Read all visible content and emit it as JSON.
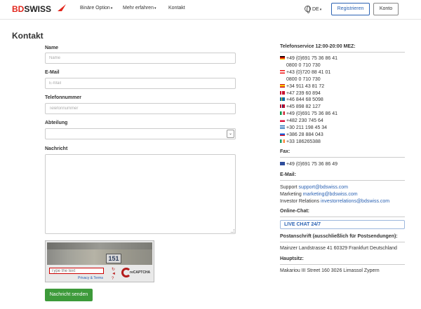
{
  "header": {
    "logo_red": "BD",
    "logo_dark": "SWISS",
    "nav": [
      {
        "label": "Binäre Option"
      },
      {
        "label": "Mehr erfahren"
      },
      {
        "label": "Kontakt"
      }
    ],
    "language": "DE",
    "register_label": "Registrieren",
    "account_label": "Konto"
  },
  "form": {
    "title": "Kontakt",
    "name_label": "Name",
    "name_placeholder": "Name",
    "email_label": "E-Mail",
    "email_placeholder": "E-Mail",
    "phone_label": "Telefonnummer",
    "phone_placeholder": "Telefonnummer",
    "department_label": "Abteilung",
    "department_value": "",
    "message_label": "Nachricht",
    "captcha_number": "151",
    "captcha_placeholder": "Type the text",
    "captcha_privacy": "Privacy & Terms",
    "captcha_brand": "reCAPTCHA",
    "submit_label": "Nachricht senden"
  },
  "sidebar": {
    "phone_heading": "Telefonservice 12:00-20:00 MEZ:",
    "phones": [
      {
        "flag": "de",
        "number": "+49 (0)691 75 36 86 41"
      },
      {
        "flag": "",
        "number": "0800 0 710 730"
      },
      {
        "flag": "at",
        "number": "+43 (0)720 88 41 01"
      },
      {
        "flag": "",
        "number": "0800 0 710 730"
      },
      {
        "flag": "es",
        "number": "+34 911 43 81 72"
      },
      {
        "flag": "dk",
        "number": "+47 239 60 894"
      },
      {
        "flag": "se",
        "number": "+46 844 68 5098"
      },
      {
        "flag": "no",
        "number": "+45 898 82 127"
      },
      {
        "flag": "it",
        "number": "+49 (0)691 75 36 86 41"
      },
      {
        "flag": "pl",
        "number": "+482 230 745 64"
      },
      {
        "flag": "gr",
        "number": "+30 211 198 45 34"
      },
      {
        "flag": "si",
        "number": "+386 28 884 043"
      },
      {
        "flag": "ie",
        "number": "+33 186265388"
      }
    ],
    "fax_heading": "Fax:",
    "fax_number": "+49 (0)691 75 36 86 49",
    "email_heading": "E-Mail:",
    "emails": [
      {
        "label": "Support",
        "address": "support@bdswiss.com"
      },
      {
        "label": "Marketing",
        "address": "marketing@bdswiss.com"
      },
      {
        "label": "Investor Relations",
        "address": "investorrelations@bdswiss.com"
      }
    ],
    "chat_heading": "Online-Chat:",
    "chat_button": "LIVE CHAT 24/7",
    "postal_heading": "Postanschrift (ausschließlich für Postsendungen):",
    "postal_address": "Mainzer Landstrasse 41 60329 Frankfurt Deutschland",
    "hq_heading": "Hauptsitz:",
    "hq_address": "Makariou III Street 160 3026 Limassol Zypern"
  },
  "colors": {
    "brand_red": "#e2261c",
    "link_blue": "#2b62b3",
    "submit_green": "#3d9a3a"
  }
}
